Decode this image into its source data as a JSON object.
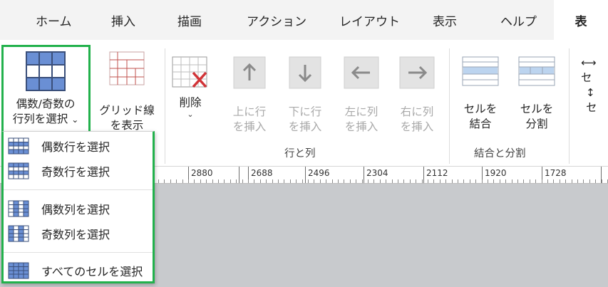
{
  "tabs": [
    {
      "label": "ホーム"
    },
    {
      "label": "挿入"
    },
    {
      "label": "描画"
    },
    {
      "label": "アクション"
    },
    {
      "label": "レイアウト"
    },
    {
      "label": "表示"
    },
    {
      "label": "ヘルプ"
    },
    {
      "label": "表"
    }
  ],
  "ribbon": {
    "select_button": {
      "line1": "偶数/奇数の",
      "line2": "行列を選択",
      "caret": "⌄"
    },
    "gridlines_button": {
      "line1": "グリッド線",
      "line2": "を表示"
    },
    "delete_button": {
      "label": "削除",
      "caret": "⌄"
    },
    "insert_above": {
      "line1": "上に行",
      "line2": "を挿入"
    },
    "insert_below": {
      "line1": "下に行",
      "line2": "を挿入"
    },
    "insert_left": {
      "line1": "左に列",
      "line2": "を挿入"
    },
    "insert_right": {
      "line1": "右に列",
      "line2": "を挿入"
    },
    "merge_cells": {
      "line1": "セルを",
      "line2": "結合"
    },
    "split_cells": {
      "line1": "セルを",
      "line2": "分割"
    },
    "partial_1": "セ",
    "partial_2": "セ",
    "group_rows_cols": "行と列",
    "group_merge_split": "結合と分割"
  },
  "ruler": {
    "labels": [
      "2880",
      "2688",
      "2496",
      "2304",
      "2112",
      "1920",
      "1728"
    ]
  },
  "dropdown": {
    "items": [
      {
        "label": "偶数行を選択",
        "icon": "even-rows-icon"
      },
      {
        "label": "奇数行を選択",
        "icon": "odd-rows-icon"
      },
      {
        "label": "偶数列を選択",
        "icon": "even-columns-icon"
      },
      {
        "label": "奇数列を選択",
        "icon": "odd-columns-icon"
      },
      {
        "label": "すべてのセルを選択",
        "icon": "all-cells-icon"
      }
    ]
  },
  "colors": {
    "highlight": "#22b14c",
    "cell_blue": "#6a8fd4",
    "delete_red": "#d13438",
    "canvas": "#c8cacd"
  }
}
